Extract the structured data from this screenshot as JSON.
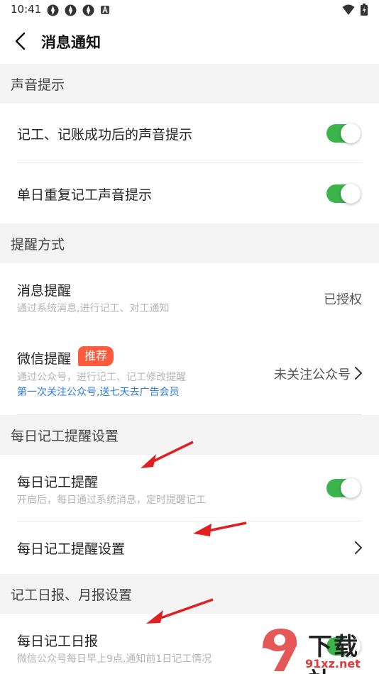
{
  "status_bar": {
    "time": "10:41"
  },
  "nav": {
    "title": "消息通知"
  },
  "sections": {
    "sound": {
      "header": "声音提示",
      "item1": "记工、记账成功后的声音提示",
      "item2": "单日重复记工声音提示"
    },
    "remind": {
      "header": "提醒方式",
      "msg_label": "消息提醒",
      "msg_sub": "通过系统消息,进行记工、对工通知",
      "msg_value": "已授权",
      "wx_label": "微信提醒",
      "wx_badge": "推荐",
      "wx_sub": "通过公众号，进行记工、记工修改提醒",
      "wx_link": "第一次关注公众号,送七天去广告会员",
      "wx_value": "未关注公众号"
    },
    "daily": {
      "header": "每日记工提醒设置",
      "item1_label": "每日记工提醒",
      "item1_sub": "开启后，每日通过系统消息，定时提醒记工",
      "item2_label": "每日记工提醒设置"
    },
    "report": {
      "header": "记工日报、月报设置",
      "item1_label": "每日记工日报",
      "item1_sub": "微信公众号每日早上9点,通知前1日记工情况"
    }
  },
  "watermark": {
    "top": "下载站",
    "bottom": "91xz.net"
  },
  "toggles": {
    "sound_success": true,
    "sound_repeat": true,
    "daily_remind": true
  },
  "colors": {
    "toggle_on": "#3bb54a",
    "badge": "#ff5a3c",
    "link": "#2b7de9",
    "arrow": "#e02020"
  }
}
